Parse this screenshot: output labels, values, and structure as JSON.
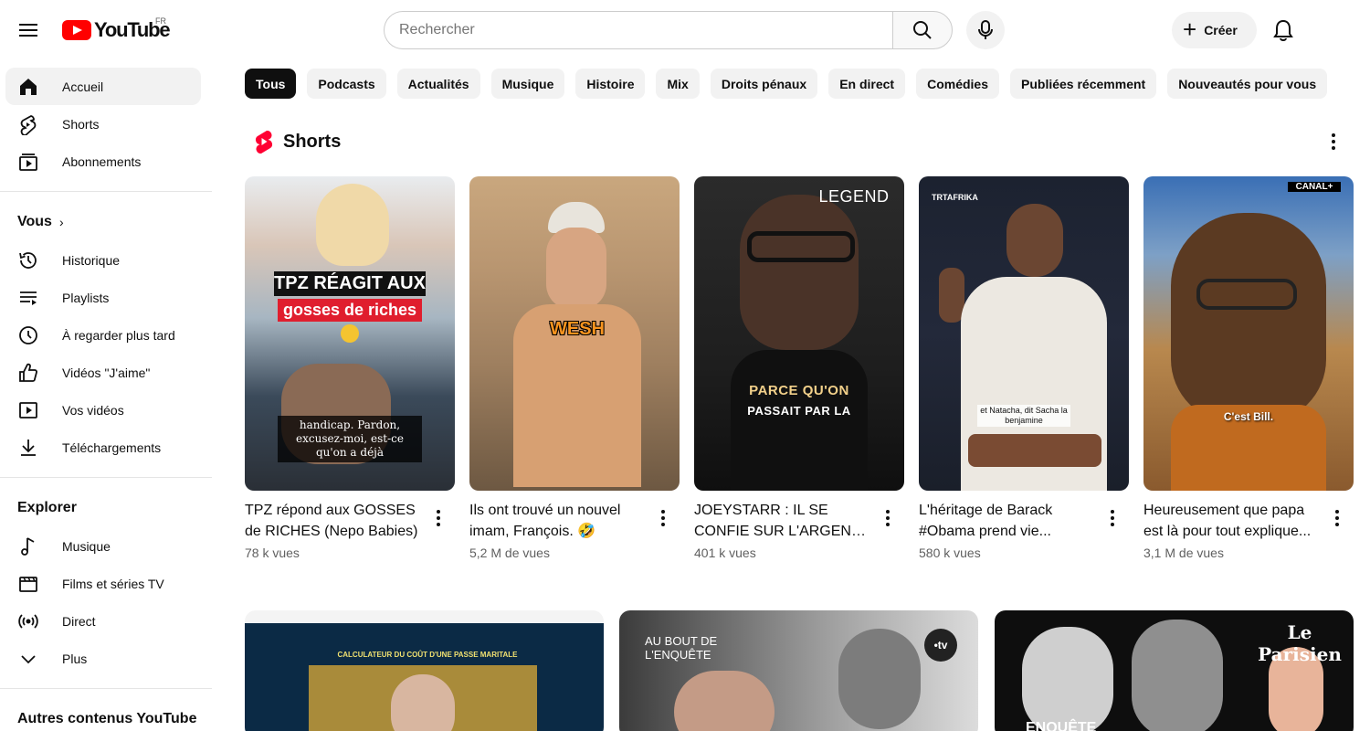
{
  "header": {
    "logo_text": "YouTube",
    "region": "FR",
    "search_placeholder": "Rechercher",
    "create_label": "Créer"
  },
  "sidebar": {
    "main": [
      {
        "label": "Accueil",
        "icon": "home-icon",
        "active": true
      },
      {
        "label": "Shorts",
        "icon": "shorts-icon"
      },
      {
        "label": "Abonnements",
        "icon": "subscriptions-icon"
      }
    ],
    "you_heading": "Vous",
    "you_items": [
      {
        "label": "Historique",
        "icon": "history-icon"
      },
      {
        "label": "Playlists",
        "icon": "playlists-icon"
      },
      {
        "label": "À regarder plus tard",
        "icon": "watch-later-icon"
      },
      {
        "label": "Vidéos \"J'aime\"",
        "icon": "thumb-up-icon"
      },
      {
        "label": "Vos vidéos",
        "icon": "your-videos-icon"
      },
      {
        "label": "Téléchargements",
        "icon": "download-icon"
      }
    ],
    "explore_heading": "Explorer",
    "explore_items": [
      {
        "label": "Musique",
        "icon": "music-icon"
      },
      {
        "label": "Films et séries TV",
        "icon": "movies-icon"
      },
      {
        "label": "Direct",
        "icon": "live-icon"
      },
      {
        "label": "Plus",
        "icon": "chevron-down-icon"
      }
    ],
    "other_heading": "Autres contenus YouTube"
  },
  "chips": [
    "Tous",
    "Podcasts",
    "Actualités",
    "Musique",
    "Histoire",
    "Mix",
    "Droits pénaux",
    "En direct",
    "Comédies",
    "Publiées récemment",
    "Nouveautés pour vous"
  ],
  "shorts": {
    "heading": "Shorts",
    "items": [
      {
        "title": "TPZ répond aux GOSSES de RICHES (Nepo Babies)",
        "views": "78 k vues",
        "overlay1": "TPZ RÉAGIT AUX",
        "overlay2": "gosses de riches",
        "caption": "handicap. Pardon, excusez-moi, est-ce qu'on a déjà"
      },
      {
        "title": "Ils ont trouvé un nouvel imam, François. 🤣",
        "views": "5,2 M de vues",
        "overlay1": "WESH"
      },
      {
        "title": "JOEYSTARR : IL SE CONFIE SUR L'ARGENT ...",
        "views": "401 k vues",
        "overlay1": "LEGEND",
        "overlay2": "PARCE QU'ON",
        "caption": "PASSAIT PAR LA"
      },
      {
        "title": "L'héritage de Barack #Obama prend vie...",
        "views": "580 k vues",
        "overlay1": "TRTAFRIKA",
        "caption": "et Natacha, dit Sacha la benjamine"
      },
      {
        "title": "Heureusement que papa est là pour tout explique...",
        "views": "3,1 M de vues",
        "overlay1": "CANAL+",
        "caption": "C'est Bill."
      }
    ]
  },
  "videos": {
    "items": [
      {
        "overlay": "CALCULATEUR DU COÛT D'UNE PASSE MARITALE"
      },
      {
        "overlay": "AU BOUT DE L'ENQUÊTE",
        "badge": "•tv"
      },
      {
        "overlay": "Le Parisien",
        "caption": "ENQUÊTE"
      }
    ]
  }
}
